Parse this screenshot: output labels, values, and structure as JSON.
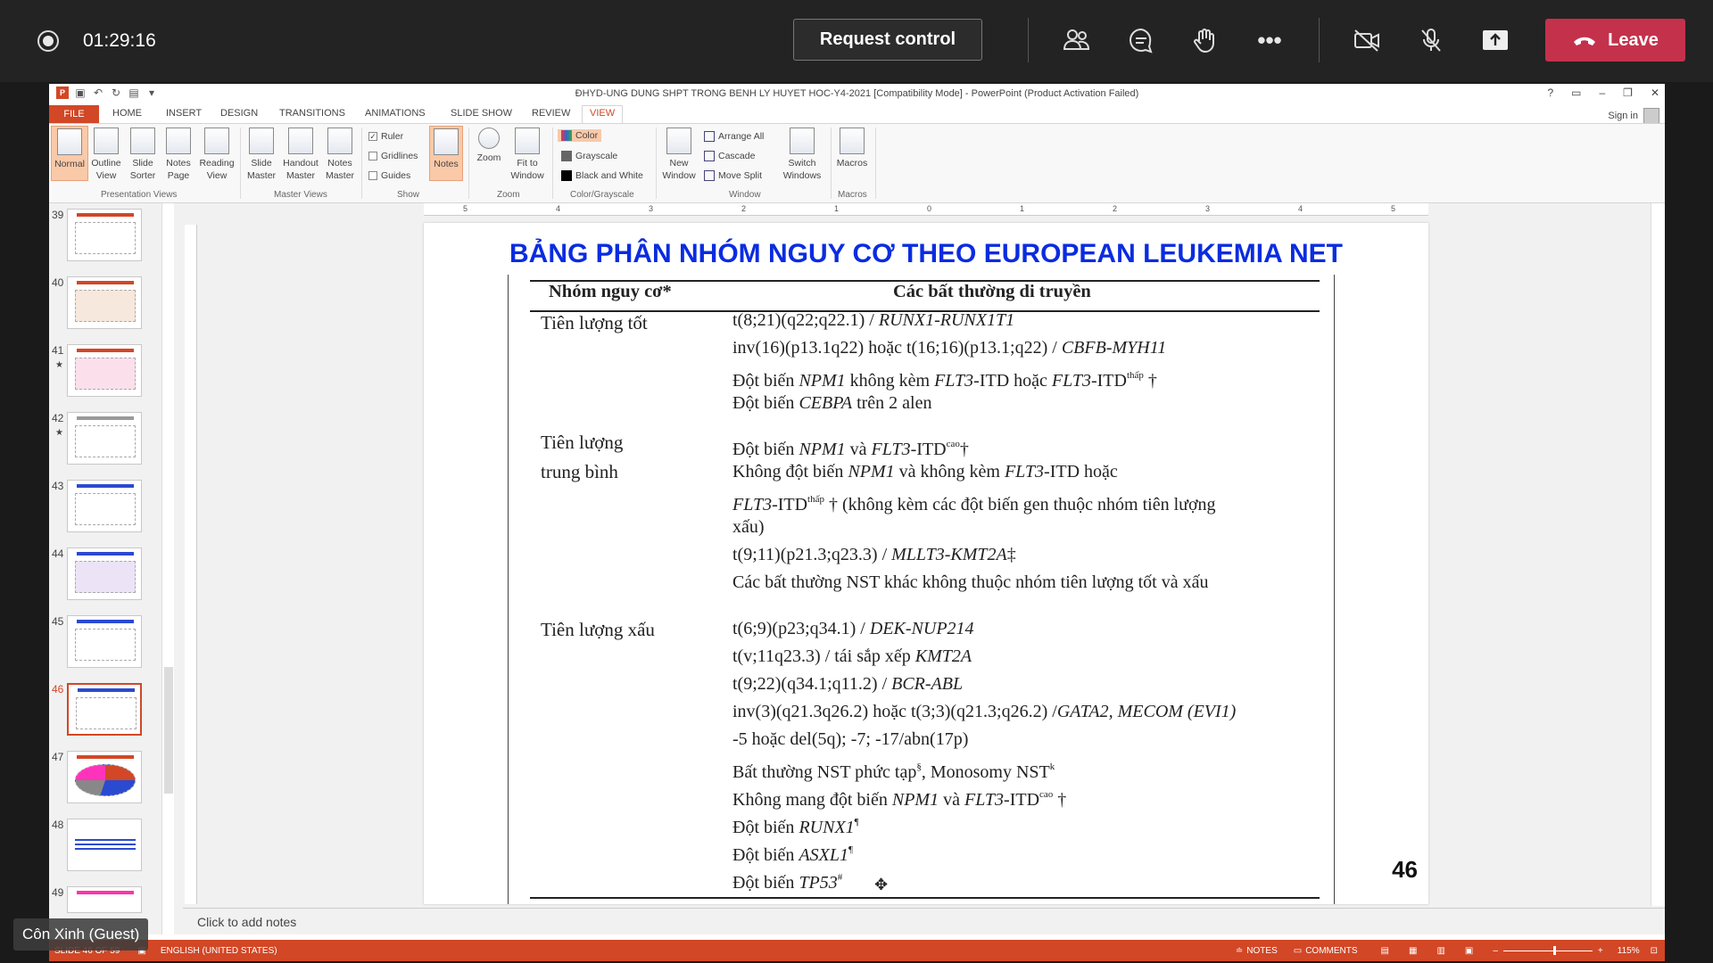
{
  "meeting": {
    "timer": "01:29:16",
    "request_control_label": "Request control",
    "leave_label": "Leave",
    "guest_name": "Côn Xinh (Guest)"
  },
  "ppt": {
    "title": "ĐHYD-UNG DUNG SHPT TRONG BENH LY HUYET HOC-Y4-2021 [Compatibility Mode] - PowerPoint (Product Activation Failed)",
    "tabs": [
      "FILE",
      "HOME",
      "INSERT",
      "DESIGN",
      "TRANSITIONS",
      "ANIMATIONS",
      "SLIDE SHOW",
      "REVIEW",
      "VIEW"
    ],
    "sign_in": "Sign in",
    "ribbon": {
      "presentation_views": {
        "label": "Presentation Views",
        "buttons": [
          "Normal",
          "Outline View",
          "Slide Sorter",
          "Notes Page",
          "Reading View"
        ]
      },
      "master_views": {
        "label": "Master Views",
        "buttons": [
          "Slide Master",
          "Handout Master",
          "Notes Master"
        ]
      },
      "show": {
        "label": "Show",
        "ruler": "Ruler",
        "gridlines": "Gridlines",
        "guides": "Guides",
        "notes": "Notes"
      },
      "zoom": {
        "label": "Zoom",
        "zoom": "Zoom",
        "fit": "Fit to Window"
      },
      "color": {
        "label": "Color/Grayscale",
        "color": "Color",
        "grayscale": "Grayscale",
        "bw": "Black and White"
      },
      "window": {
        "label": "Window",
        "new_window": "New Window",
        "arrange_all": "Arrange All",
        "cascade": "Cascade",
        "move_split": "Move Split",
        "switch": "Switch Windows"
      },
      "macros": {
        "label": "Macros",
        "macros": "Macros"
      }
    },
    "thumb_numbers": [
      "39",
      "40",
      "41",
      "42",
      "43",
      "44",
      "45",
      "46",
      "47",
      "48",
      "49"
    ],
    "ruler_labels": [
      "5",
      "4",
      "3",
      "2",
      "1",
      "0",
      "1",
      "2",
      "3",
      "4",
      "5"
    ],
    "notes_placeholder": "Click to add notes",
    "status": {
      "slide": "SLIDE 46 OF 59",
      "language": "ENGLISH (UNITED STATES)",
      "notes": "NOTES",
      "comments": "COMMENTS",
      "zoom": "115%"
    }
  },
  "slide": {
    "title": "BẢNG PHÂN NHÓM NGUY CƠ THEO EUROPEAN LEUKEMIA NET",
    "col1_header": "Nhóm nguy cơ*",
    "col2_header": "Các bất thường di truyền",
    "page_number": "46",
    "groups": [
      {
        "name_lines": [
          "Tiên lượng tốt"
        ]
      },
      {
        "name_lines": [
          "Tiên lượng",
          "trung bình"
        ]
      },
      {
        "name_lines": [
          "Tiên lượng xấu"
        ]
      }
    ]
  },
  "colors": {
    "ppt_accent": "#d24726",
    "leave_red": "#c4314b",
    "title_blue": "#0a2ce0"
  }
}
